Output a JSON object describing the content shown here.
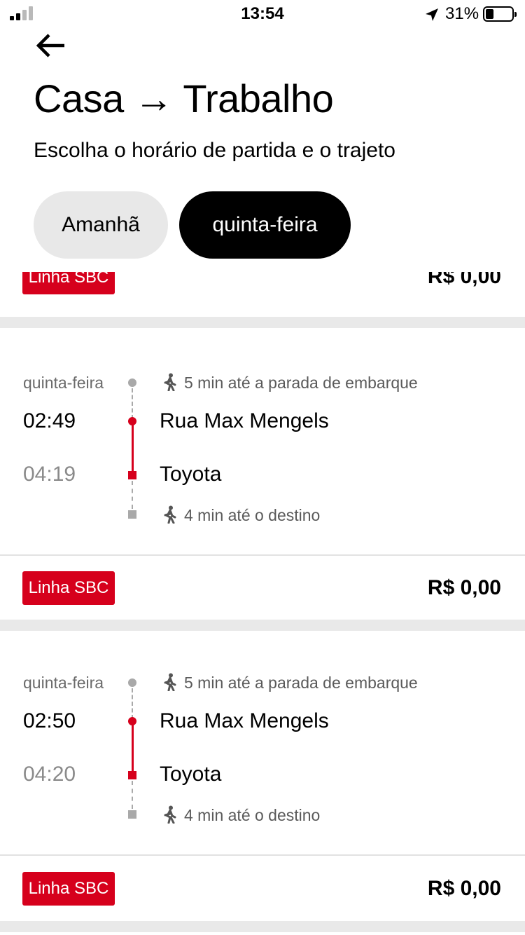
{
  "status_bar": {
    "time": "13:54",
    "battery_percent": "31%",
    "battery_level": 0.31
  },
  "header": {
    "title": "Casa → Trabalho",
    "subtitle": "Escolha o horário de partida e o trajeto"
  },
  "day_chips": [
    {
      "label": "Amanhã",
      "selected": false
    },
    {
      "label": "quinta-feira",
      "selected": true
    }
  ],
  "top_partial_card": {
    "line": "Linha SBC",
    "price": "R$ 0,00"
  },
  "trips": [
    {
      "day": "quinta-feira",
      "walk_to_stop": "5 min até a parada de embarque",
      "departure_time": "02:49",
      "departure_stop": "Rua Max Mengels",
      "arrival_time": "04:19",
      "arrival_stop": "Toyota",
      "walk_to_destination": "4 min até o destino",
      "line": "Linha SBC",
      "price": "R$ 0,00"
    },
    {
      "day": "quinta-feira",
      "walk_to_stop": "5 min até a parada de embarque",
      "departure_time": "02:50",
      "departure_stop": "Rua Max Mengels",
      "arrival_time": "04:20",
      "arrival_stop": "Toyota",
      "walk_to_destination": "4 min até o destino",
      "line": "Linha SBC",
      "price": "R$ 0,00"
    }
  ],
  "colors": {
    "accent_red": "#d6001c",
    "chip_selected_bg": "#000000",
    "chip_unselected_bg": "#e8e8e8",
    "separator": "#e9e9e9"
  },
  "icons": [
    "back-arrow-icon",
    "location-arrow-icon",
    "walking-person-icon",
    "battery-icon",
    "signal-icon"
  ]
}
